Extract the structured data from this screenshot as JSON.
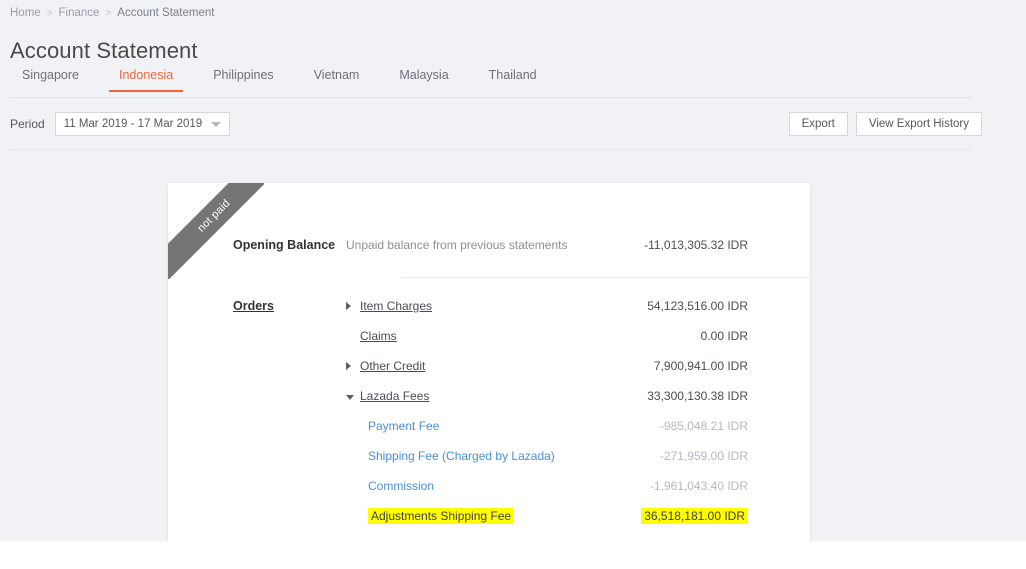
{
  "breadcrumb": [
    {
      "label": "Home"
    },
    {
      "label": "Finance"
    },
    {
      "label": "Account Statement"
    }
  ],
  "breadcrumb_separator": ">",
  "page_title": "Account Statement",
  "tabs": [
    {
      "label": "Singapore",
      "active": false
    },
    {
      "label": "Indonesia",
      "active": true
    },
    {
      "label": "Philippines",
      "active": false
    },
    {
      "label": "Vietnam",
      "active": false
    },
    {
      "label": "Malaysia",
      "active": false
    },
    {
      "label": "Thailand",
      "active": false
    }
  ],
  "toolbar": {
    "period_label": "Period",
    "period_value": "11 Mar 2019 - 17 Mar 2019",
    "export_label": "Export",
    "export_history_label": "View Export History"
  },
  "card": {
    "ribbon_text": "not paid",
    "opening": {
      "name": "Opening Balance",
      "description": "Unpaid balance from previous statements",
      "amount": "-11,013,305.32 IDR"
    },
    "orders": {
      "section_label": "Orders",
      "rows": [
        {
          "label": "Item Charges",
          "amount": "54,123,516.00 IDR",
          "twisty": "collapsed"
        },
        {
          "label": "Claims",
          "amount": "0.00 IDR",
          "twisty": "none"
        },
        {
          "label": "Other Credit",
          "amount": "7,900,941.00 IDR",
          "twisty": "collapsed"
        },
        {
          "label": "Lazada Fees",
          "amount": "33,300,130.38 IDR",
          "twisty": "expanded"
        }
      ],
      "sub_rows": [
        {
          "label": "Payment Fee",
          "amount": "-985,048.21 IDR",
          "highlighted": false
        },
        {
          "label": "Shipping Fee (Charged by Lazada)",
          "amount": "-271,959.00 IDR",
          "highlighted": false
        },
        {
          "label": "Commission",
          "amount": "-1,961,043.40 IDR",
          "highlighted": false
        },
        {
          "label": "Adjustments Shipping Fee",
          "amount": "36,518,181.00 IDR",
          "highlighted": true
        }
      ]
    }
  },
  "colors": {
    "accent": "#f1663b",
    "page_background": "#f1f2f5",
    "card_background": "#ffffff",
    "ribbon": "#757575",
    "highlight": "#ffff00",
    "sub_link": "#4d8fd0"
  }
}
